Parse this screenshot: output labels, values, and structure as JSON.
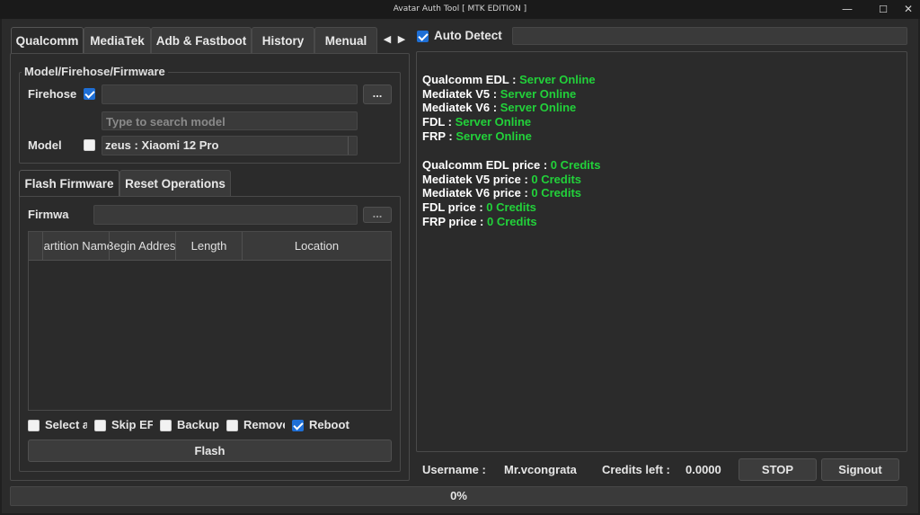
{
  "window": {
    "title": "Avatar Auth Tool [ MTK EDITION ]",
    "minimize": "—",
    "maximize": "☐",
    "close": "✕"
  },
  "tabs": [
    {
      "label": "Qualcomm",
      "active": true
    },
    {
      "label": "MediaTek"
    },
    {
      "label": "Adb & Fastboot"
    },
    {
      "label": "History"
    },
    {
      "label": "Menual"
    }
  ],
  "tab_scroll": {
    "left": "◀",
    "right": "▶"
  },
  "auto_detect": {
    "label": "Auto Detect",
    "checked": true,
    "value": ""
  },
  "model_group": {
    "title": "Model/Firehose/Firmware",
    "firehose_label": "Firehose",
    "firehose_checked": true,
    "firehose_value": "",
    "browse_label": "...",
    "search_placeholder": "Type to search model",
    "model_label": "Model",
    "model_checked": false,
    "model_value": "zeus : Xiaomi 12 Pro"
  },
  "sub_tabs": [
    {
      "label": "Flash Firmware",
      "active": true
    },
    {
      "label": "Reset Operations"
    }
  ],
  "firmware": {
    "label": "Firmware",
    "value": "",
    "browse_label": "...",
    "columns": [
      "Partition Name",
      "Begin Address",
      "Length",
      "Location"
    ],
    "options": [
      {
        "label": "Select all",
        "checked": false
      },
      {
        "label": "Skip EFS",
        "checked": false
      },
      {
        "label": "Backup",
        "checked": false
      },
      {
        "label": "Remove",
        "checked": false
      },
      {
        "label": "Reboot",
        "checked": true
      }
    ],
    "flash_label": "Flash"
  },
  "server_status": [
    {
      "key": "Qualcomm EDL : ",
      "value": "Server Online"
    },
    {
      "key": "Mediatek V5 : ",
      "value": "Server Online"
    },
    {
      "key": "Mediatek V6 : ",
      "value": "Server Online"
    },
    {
      "key": "FDL : ",
      "value": "Server Online"
    },
    {
      "key": "FRP : ",
      "value": "Server Online"
    }
  ],
  "prices": [
    {
      "key": "Qualcomm EDL price : ",
      "value": "0 Credits"
    },
    {
      "key": "Mediatek V5 price : ",
      "value": "0 Credits"
    },
    {
      "key": "Mediatek V6 price : ",
      "value": "0 Credits"
    },
    {
      "key": "FDL price : ",
      "value": "0 Credits"
    },
    {
      "key": "FRP price : ",
      "value": "0 Credits"
    }
  ],
  "account": {
    "username_label": "Username :",
    "username": "Mr.vcongrata",
    "credits_label": "Credits left :",
    "credits": "0.0000",
    "stop_label": "STOP",
    "signout_label": "Signout"
  },
  "progress": {
    "text": "0%",
    "value": 0
  },
  "colors": {
    "online": "#22d13a",
    "checkbox": "#1e6fd6",
    "background": "#2b2b2b"
  }
}
